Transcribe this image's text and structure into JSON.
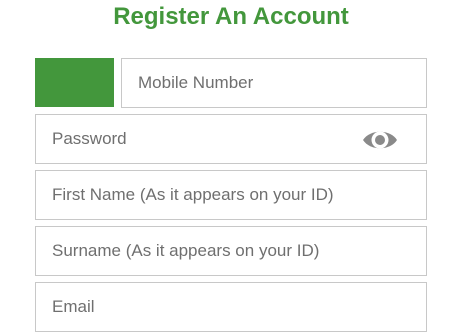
{
  "header": {
    "title": "Register An Account"
  },
  "form": {
    "mobile": {
      "placeholder": "Mobile Number",
      "value": ""
    },
    "password": {
      "placeholder": "Password",
      "value": ""
    },
    "first_name": {
      "placeholder": "First Name (As it appears on your ID)",
      "value": ""
    },
    "surname": {
      "placeholder": "Surname (As it appears on your ID)",
      "value": ""
    },
    "email": {
      "placeholder": "Email",
      "value": ""
    }
  },
  "icons": {
    "password_toggle": "eye-icon"
  },
  "colors": {
    "accent": "#43973c",
    "border": "#c8c8c8",
    "placeholder": "#6f6f6f",
    "icon": "#8a8a8a"
  }
}
